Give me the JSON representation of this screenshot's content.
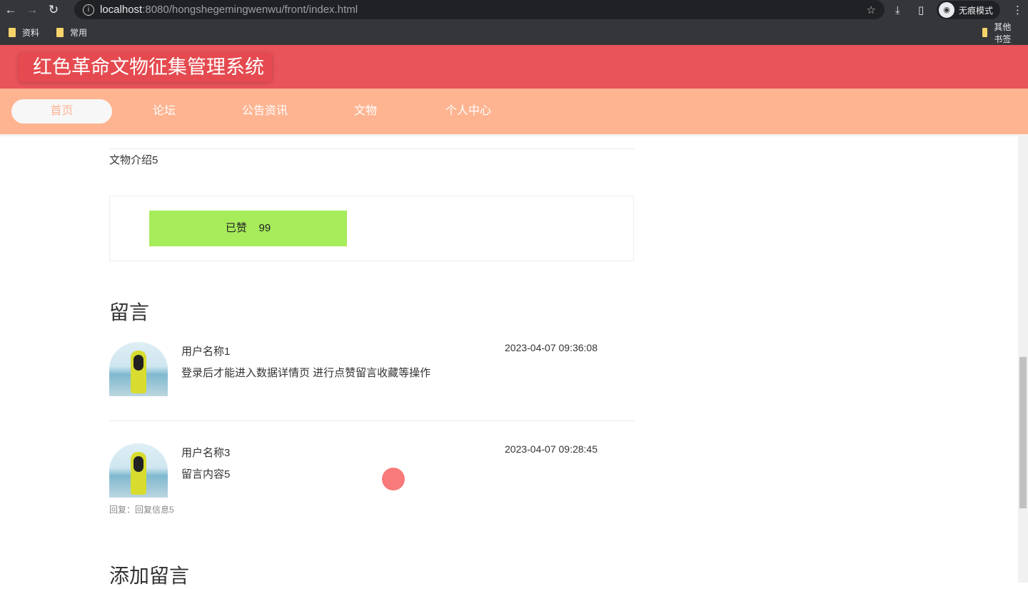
{
  "browser": {
    "url_host": "localhost",
    "url_rest": ":8080/hongshegemingwenwu/front/index.html",
    "incognito_label": "无痕模式",
    "bookmarks": [
      {
        "label": "资料"
      },
      {
        "label": "常用"
      }
    ],
    "other_bookmarks": "其他书签"
  },
  "header": {
    "title": "红色革命文物征集管理系统"
  },
  "nav": {
    "items": [
      {
        "label": "首页"
      },
      {
        "label": "论坛"
      },
      {
        "label": "公告资讯"
      },
      {
        "label": "文物"
      },
      {
        "label": "个人中心"
      }
    ]
  },
  "detail": {
    "intro": "文物介绍5",
    "like_label": "已赞",
    "like_count": "99"
  },
  "comments": {
    "title": "留言",
    "items": [
      {
        "user": "用户名称1",
        "text": "登录后才能进入数据详情页 进行点赞留言收藏等操作",
        "time": "2023-04-07 09:36:08"
      },
      {
        "user": "用户名称3",
        "text": "留言内容5",
        "time": "2023-04-07 09:28:45",
        "reply": "回复：回复信息5"
      }
    ]
  },
  "add_comment": {
    "title": "添加留言"
  }
}
